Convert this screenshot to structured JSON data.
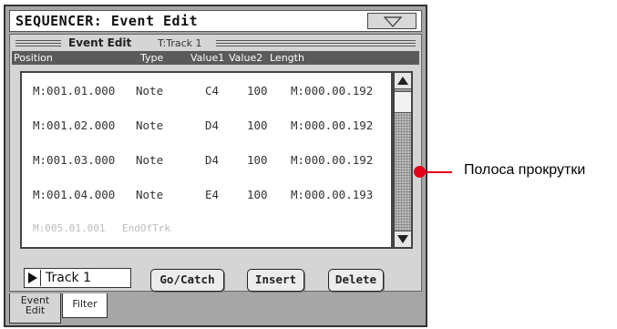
{
  "window": {
    "title": "SEQUENCER: Event Edit",
    "menu_icon": "triangle-down-icon"
  },
  "header": {
    "title": "Event Edit",
    "track": "T:Track 1"
  },
  "columns": [
    "Position",
    "Type",
    "Value1",
    "Value2",
    "Length"
  ],
  "rows": [
    {
      "position": "M:001.01.000",
      "type": "Note",
      "value1": "C4",
      "value2": "100",
      "length": "M:000.00.192"
    },
    {
      "position": "M:001.02.000",
      "type": "Note",
      "value1": "D4",
      "value2": "100",
      "length": "M:000.00.192"
    },
    {
      "position": "M:001.03.000",
      "type": "Note",
      "value1": "D4",
      "value2": "100",
      "length": "M:000.00.192"
    },
    {
      "position": "M:001.04.000",
      "type": "Note",
      "value1": "E4",
      "value2": "100",
      "length": "M:000.00.193"
    },
    {
      "position": "M:005.01.001",
      "type": "EndOfTrk",
      "value1": "",
      "value2": "",
      "length": ""
    }
  ],
  "track_selector": {
    "label": "Track 1"
  },
  "buttons": {
    "gocatch": "Go/Catch",
    "insert": "Insert",
    "delete": "Delete"
  },
  "tabs": [
    {
      "label_line1": "Event",
      "label_line2": "Edit",
      "active": true
    },
    {
      "label": "Filter",
      "active": false
    }
  ],
  "callout": {
    "text": "Полоса прокрутки",
    "color": "#e2001a"
  }
}
